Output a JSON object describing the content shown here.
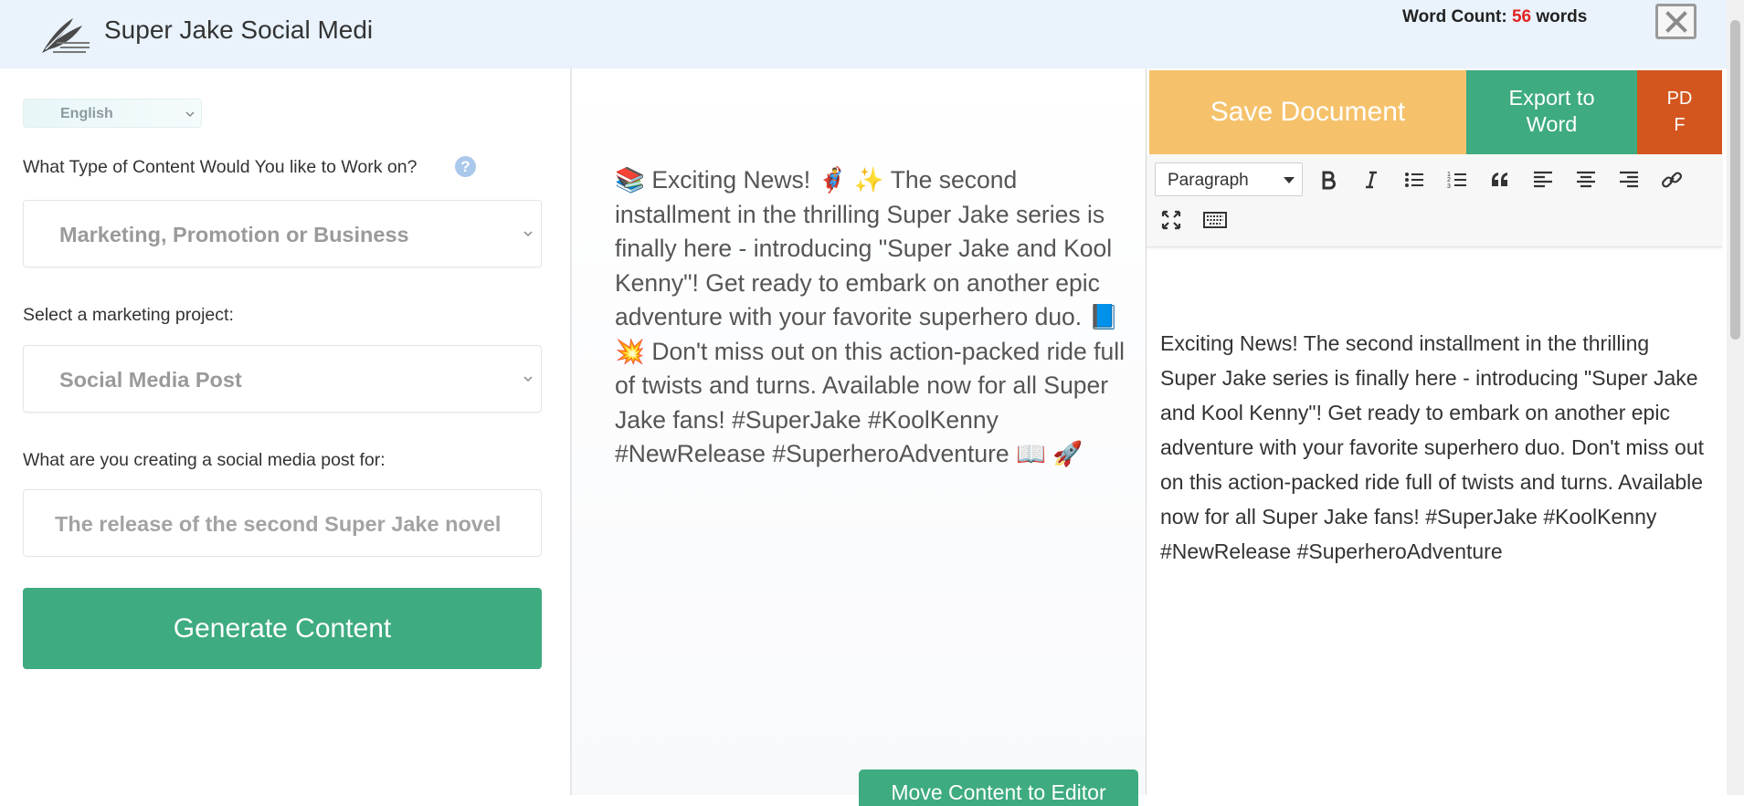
{
  "header": {
    "app_title": "Super Jake Social Medi",
    "word_count_label": "Word Count:",
    "word_count_value": "56",
    "word_count_unit": "words",
    "icons": {
      "logo": "quill-logo-icon",
      "close": "close-icon"
    }
  },
  "left_panel": {
    "language": "English",
    "content_type_label": "What Type of Content Would You like to Work on?",
    "content_type_value": "Marketing, Promotion or Business",
    "project_label": "Select a marketing project:",
    "project_value": "Social Media Post",
    "purpose_label": "What are you creating a social media post for:",
    "purpose_value": "The release of the second Super Jake novel",
    "generate_button": "Generate Content",
    "help_glyph": "?"
  },
  "middle_panel": {
    "generated_text": "📚 Exciting News! 🦸‍♂️ ✨ The second installment in the thrilling Super Jake series is finally here - introducing \"Super Jake and Kool Kenny\"! Get ready to embark on another epic adventure with your favorite superhero duo. 📘 💥 Don't miss out on this action-packed ride full of twists and turns. Available now for all Super Jake fans! #SuperJake #KoolKenny #NewRelease #SuperheroAdventure 📖 🚀",
    "move_button": "Move Content to Editor"
  },
  "right_panel": {
    "save_button": "Save Document",
    "export_word_button": "Export to Word",
    "export_pdf_button": "PDF",
    "block_format": "Paragraph",
    "toolbar_icons": [
      "bold-icon",
      "italic-icon",
      "bullet-list-icon",
      "numbered-list-icon",
      "blockquote-icon",
      "align-left-icon",
      "align-center-icon",
      "align-right-icon",
      "link-icon",
      "fullscreen-icon",
      "keyboard-icon"
    ],
    "editor_text": "Exciting News! The second installment in the thrilling Super Jake series is finally here - introducing \"Super Jake and Kool Kenny\"! Get ready to embark on another epic adventure with your favorite superhero duo. Don't miss out on this action-packed ride full of twists and turns. Available now for all Super Jake fans! #SuperJake #KoolKenny #NewRelease #SuperheroAdventure"
  },
  "colors": {
    "header_bg": "#eaf3fc",
    "green_accent": "#3eab80",
    "save_orange": "#f5c26b",
    "pdf_red": "#d4561f",
    "word_count_red": "#e02424"
  }
}
